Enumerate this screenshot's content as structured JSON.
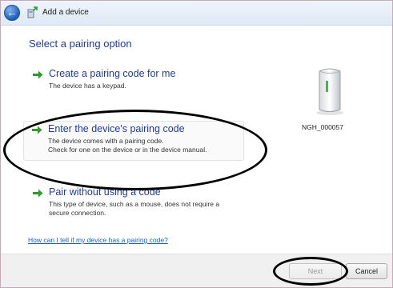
{
  "window": {
    "title": "Add a device",
    "back_icon": "back-arrow-icon",
    "wizard_icon": "add-device-icon"
  },
  "heading": "Select a pairing option",
  "options": [
    {
      "title": "Create a pairing code for me",
      "description": [
        "The device has a keypad."
      ],
      "icon": "green-arrow-icon"
    },
    {
      "title": "Enter the device's pairing code",
      "description": [
        "The device comes with a pairing code.",
        "Check for one on the device or in the device manual."
      ],
      "icon": "green-arrow-icon",
      "highlighted": true
    },
    {
      "title": "Pair without using a code",
      "description": [
        "This type of device, such as a mouse, does not require a",
        "secure connection."
      ],
      "icon": "green-arrow-icon"
    }
  ],
  "device": {
    "name": "NGH_000057",
    "icon": "device-tower-icon"
  },
  "help_link": "How can I tell if my device has a pairing code?",
  "footer": {
    "next_label": "Next",
    "next_disabled": true,
    "cancel_label": "Cancel"
  },
  "colors": {
    "link_blue": "#1a5fc9",
    "heading_blue": "#1f3b9e",
    "arrow_green": "#2e9a2e",
    "annotation_black": "#000000"
  }
}
